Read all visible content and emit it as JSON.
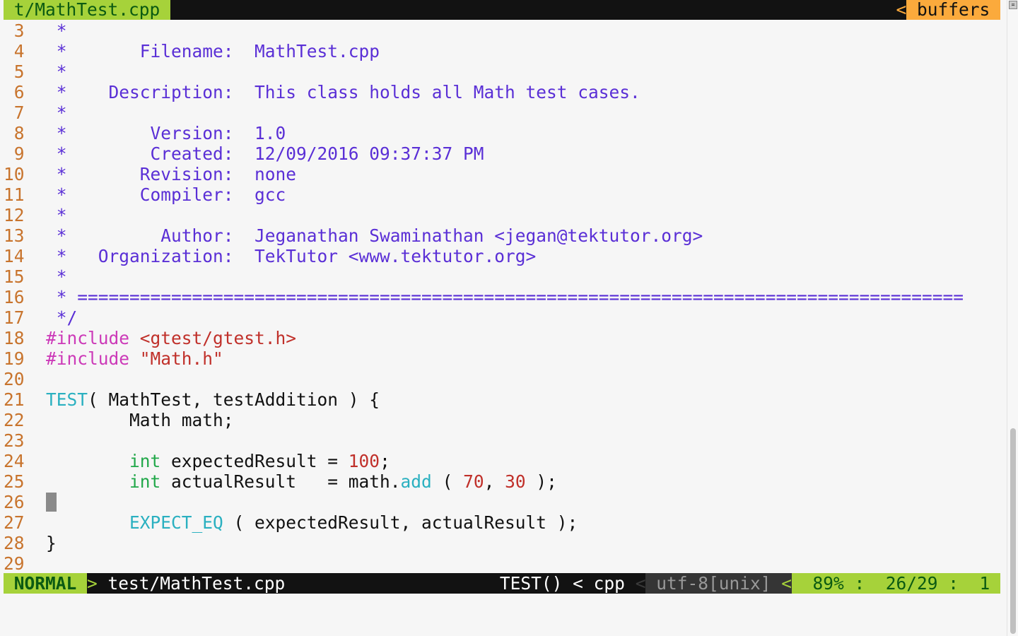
{
  "tabline": {
    "current_tab": " t/MathTest.cpp ",
    "separator": "<",
    "buffers_label": " buffers "
  },
  "editor": {
    "lines": [
      {
        "num": " 3 ",
        "segs": [
          {
            "t": " *",
            "c": "cm"
          }
        ]
      },
      {
        "num": " 4 ",
        "segs": [
          {
            "t": " *       Filename:  MathTest.cpp",
            "c": "cm"
          }
        ]
      },
      {
        "num": " 5 ",
        "segs": [
          {
            "t": " *",
            "c": "cm"
          }
        ]
      },
      {
        "num": " 6 ",
        "segs": [
          {
            "t": " *    Description:  This class holds all Math test cases.",
            "c": "cm"
          }
        ]
      },
      {
        "num": " 7 ",
        "segs": [
          {
            "t": " *",
            "c": "cm"
          }
        ]
      },
      {
        "num": " 8 ",
        "segs": [
          {
            "t": " *        Version:  1.0",
            "c": "cm"
          }
        ]
      },
      {
        "num": " 9 ",
        "segs": [
          {
            "t": " *        Created:  12/09/2016 09:37:37 PM",
            "c": "cm"
          }
        ]
      },
      {
        "num": "10 ",
        "segs": [
          {
            "t": " *       Revision:  none",
            "c": "cm"
          }
        ]
      },
      {
        "num": "11 ",
        "segs": [
          {
            "t": " *       Compiler:  gcc",
            "c": "cm"
          }
        ]
      },
      {
        "num": "12 ",
        "segs": [
          {
            "t": " *",
            "c": "cm"
          }
        ]
      },
      {
        "num": "13 ",
        "segs": [
          {
            "t": " *         Author:  Jeganathan Swaminathan <jegan@tektutor.org>",
            "c": "cm"
          }
        ]
      },
      {
        "num": "14 ",
        "segs": [
          {
            "t": " *   Organization:  TekTutor <www.tektutor.org>",
            "c": "cm"
          }
        ]
      },
      {
        "num": "15 ",
        "segs": [
          {
            "t": " *",
            "c": "cm"
          }
        ]
      },
      {
        "num": "16 ",
        "segs": [
          {
            "t": " * =====================================================================================",
            "c": "cm"
          }
        ]
      },
      {
        "num": "17 ",
        "segs": [
          {
            "t": " */",
            "c": "cm"
          }
        ]
      },
      {
        "num": "18 ",
        "segs": [
          {
            "t": "#include",
            "c": "pp"
          },
          {
            "t": " <gtest/gtest.h>",
            "c": "str"
          }
        ]
      },
      {
        "num": "19 ",
        "segs": [
          {
            "t": "#include",
            "c": "pp"
          },
          {
            "t": " \"Math.h\"",
            "c": "str"
          }
        ]
      },
      {
        "num": "20 ",
        "segs": []
      },
      {
        "num": "21 ",
        "segs": [
          {
            "t": "TEST",
            "c": "kw"
          },
          {
            "t": "( MathTest, testAddition ) {",
            "c": "tx"
          }
        ]
      },
      {
        "num": "22 ",
        "segs": [
          {
            "t": "        Math math;",
            "c": "tx"
          }
        ]
      },
      {
        "num": "23 ",
        "segs": []
      },
      {
        "num": "24 ",
        "segs": [
          {
            "t": "        ",
            "c": "tx"
          },
          {
            "t": "int",
            "c": "ty"
          },
          {
            "t": " expectedResult = ",
            "c": "tx"
          },
          {
            "t": "100",
            "c": "num"
          },
          {
            "t": ";",
            "c": "tx"
          }
        ]
      },
      {
        "num": "25 ",
        "segs": [
          {
            "t": "        ",
            "c": "tx"
          },
          {
            "t": "int",
            "c": "ty"
          },
          {
            "t": " actualResult   = math.",
            "c": "tx"
          },
          {
            "t": "add",
            "c": "fn"
          },
          {
            "t": " ( ",
            "c": "tx"
          },
          {
            "t": "70",
            "c": "num"
          },
          {
            "t": ", ",
            "c": "tx"
          },
          {
            "t": "30",
            "c": "num"
          },
          {
            "t": " );",
            "c": "tx"
          }
        ]
      },
      {
        "num": "26 ",
        "segs": [],
        "cursor": true
      },
      {
        "num": "27 ",
        "segs": [
          {
            "t": "        ",
            "c": "tx"
          },
          {
            "t": "EXPECT_EQ",
            "c": "kw"
          },
          {
            "t": " ( expectedResult, actualResult );",
            "c": "tx"
          }
        ]
      },
      {
        "num": "28 ",
        "segs": [
          {
            "t": "}",
            "c": "tx"
          }
        ]
      },
      {
        "num": "29 ",
        "segs": []
      }
    ]
  },
  "statusline": {
    "mode": " NORMAL ",
    "sep1": ">",
    "filename": " test/MathTest.cpp",
    "function": "TEST() < cpp ",
    "sep2": "<",
    "encoding": " utf-8[unix] ",
    "sep3": "<",
    "position": "  89% :  26/29 :  1 "
  }
}
